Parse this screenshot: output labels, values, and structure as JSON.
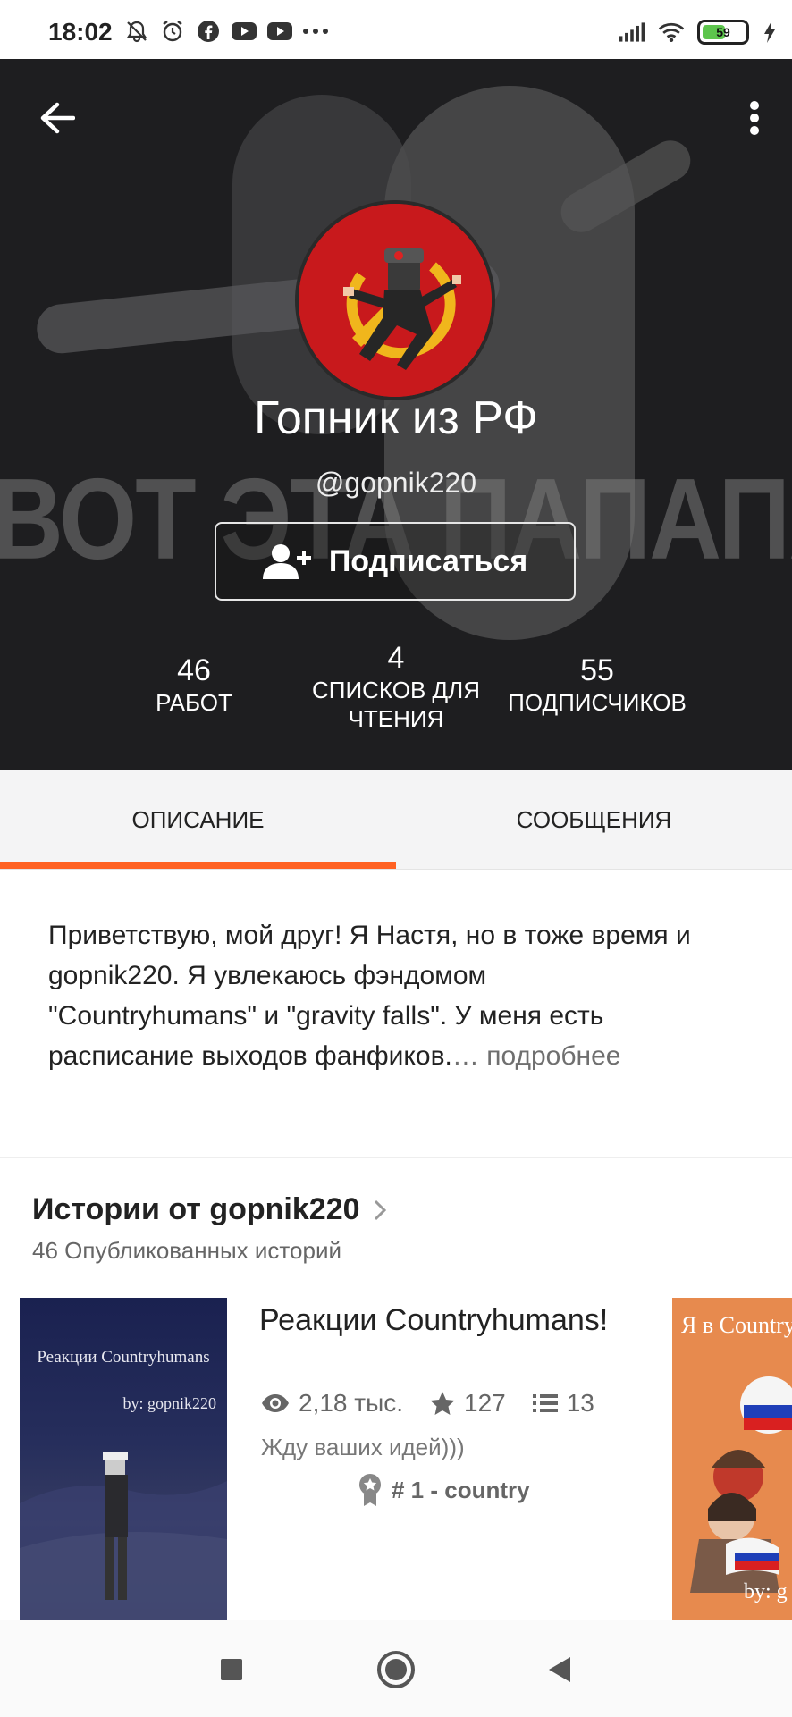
{
  "status_bar": {
    "time": "18:02",
    "battery": "59",
    "battery_level": 0.59,
    "left_icons": [
      "bell-off-icon",
      "alarm-icon",
      "facebook-icon",
      "youtube-icon",
      "youtube-icon",
      "more-dots-icon"
    ],
    "right_icons": [
      "signal-icon",
      "wifi-icon",
      "battery-icon",
      "charging-icon"
    ]
  },
  "header": {
    "watermark": "ВОТ ЭТА ПАПАПАВАРОТ",
    "name": "Гопник из РФ",
    "handle": "@gopnik220",
    "follow_label": "Подписаться"
  },
  "stats": {
    "works": {
      "value": "46",
      "label": "РАБОТ"
    },
    "reading_lists": {
      "value": "4",
      "label_line1": "СПИСКОВ ДЛЯ",
      "label_line2": "ЧТЕНИЯ"
    },
    "followers": {
      "value": "55",
      "label": "ПОДПИСЧИКОВ"
    }
  },
  "tabs": {
    "description": "ОПИСАНИЕ",
    "messages": "СООБЩЕНИЯ",
    "active": "description"
  },
  "description": {
    "text": "Приветствую, мой друг! Я Настя, но в тоже время и gopnik220. Я увлекаюсь фэндомом \"Countryhumans\" и \"gravity falls\". У меня есть расписание выходов фанфиков.",
    "ellipsis": "…",
    "more": " подробнее"
  },
  "stories": {
    "title": "Истории от gopnik220",
    "count": "46 Опубликованных историй",
    "items": [
      {
        "cover_title": "Реакции Countryhumans",
        "cover_by": "by: gopnik220",
        "title": "Реакции Countryhumans!",
        "views": "2,18 тыс.",
        "votes": "127",
        "parts": "13",
        "desc": "Жду ваших идей)))",
        "rank": "# 1 - country"
      },
      {
        "cover_title": "Я в Countryh",
        "cover_by": "by: g"
      }
    ]
  },
  "colors": {
    "accent": "#ff6122",
    "header_bg": "#1e1e20"
  }
}
